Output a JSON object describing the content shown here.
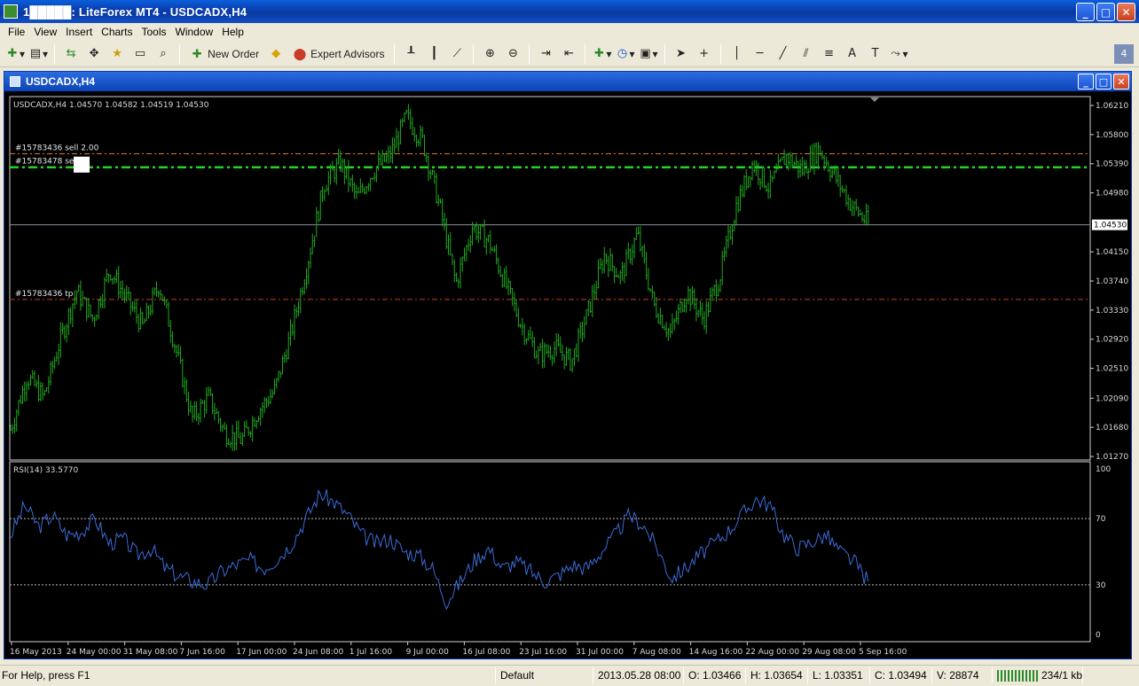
{
  "window": {
    "title": "1█████: LiteForex MT4 - USDCADX,H4"
  },
  "menu": [
    "File",
    "View",
    "Insert",
    "Charts",
    "Tools",
    "Window",
    "Help"
  ],
  "toolbar": {
    "new_order": "New Order",
    "expert_advisors": "Expert Advisors",
    "badge": "4"
  },
  "chart_window": {
    "title": "USDCADX,H4"
  },
  "chart_data": [
    {
      "type": "bar",
      "title": "USDCADX,H4  1.04570 1.04582 1.04519 1.04530",
      "symbol": "USDCADX,H4",
      "ohlc": {
        "open": 1.0457,
        "high": 1.04582,
        "low": 1.04519,
        "close": 1.0453
      },
      "price_axis_ticks": [
        "1.06210",
        "1.05800",
        "1.05390",
        "1.04980",
        "1.04150",
        "1.03740",
        "1.03330",
        "1.02920",
        "1.02510",
        "1.02090",
        "1.01680",
        "1.01270"
      ],
      "current_price": "1.04530",
      "ylim": [
        1.0127,
        1.0621
      ],
      "x_labels": [
        "16 May 2013",
        "24 May 00:00",
        "31 May 08:00",
        "7 Jun 16:00",
        "17 Jun 00:00",
        "24 Jun 08:00",
        "1 Jul 16:00",
        "9 Jul 00:00",
        "16 Jul 08:00",
        "23 Jul 16:00",
        "31 Jul 00:00",
        "7 Aug 08:00",
        "14 Aug 16:00",
        "22 Aug 00:00",
        "29 Aug 08:00",
        "5 Sep 16:00"
      ],
      "price_path": [
        1.0165,
        1.024,
        1.021,
        1.029,
        1.036,
        1.032,
        1.039,
        1.035,
        1.031,
        1.037,
        1.028,
        1.018,
        1.021,
        1.016,
        1.015,
        1.019,
        1.022,
        1.03,
        1.04,
        1.051,
        1.054,
        1.049,
        1.053,
        1.055,
        1.0605,
        1.057,
        1.048,
        1.037,
        1.045,
        1.043,
        1.037,
        1.031,
        1.027,
        1.028,
        1.026,
        1.033,
        1.041,
        1.038,
        1.044,
        1.034,
        1.03,
        1.036,
        1.032,
        1.038,
        1.048,
        1.054,
        1.0505,
        1.055,
        1.053,
        1.056,
        1.052,
        1.048,
        1.0455
      ],
      "orders": [
        {
          "label": "#15783436 sell 2.00",
          "price": 1.0553,
          "color": "#e07a1e"
        },
        {
          "label": "#15783478 sell",
          "price": 1.0534,
          "color": "#22d422"
        },
        {
          "label": "#15783436 tp",
          "price": 1.0348,
          "color": "#c83c28"
        }
      ],
      "series_color": "#1faa1f"
    },
    {
      "type": "line",
      "title": "RSI(14) 33.5770",
      "ylim": [
        0,
        100
      ],
      "y_ticks": [
        "100",
        "70",
        "30",
        "0"
      ],
      "levels": [
        70,
        30
      ],
      "rsi_path": [
        60,
        78,
        65,
        72,
        60,
        62,
        70,
        55,
        58,
        48,
        52,
        40,
        35,
        32,
        30,
        38,
        42,
        45,
        40,
        46,
        55,
        70,
        85,
        80,
        72,
        60,
        55,
        58,
        50,
        48,
        40,
        20,
        32,
        45,
        52,
        40,
        44,
        38,
        32,
        36,
        42,
        40,
        50,
        60,
        72,
        66,
        52,
        34,
        40,
        48,
        55,
        62,
        72,
        82,
        78,
        60,
        52,
        56,
        60,
        50,
        44,
        32
      ],
      "series_color": "#3a6cd8"
    }
  ],
  "status": {
    "help": "For Help, press F1",
    "profile": "Default",
    "datetime": "2013.05.28 08:00",
    "open": "O: 1.03466",
    "high": "H: 1.03654",
    "low": "L: 1.03351",
    "close": "C: 1.03494",
    "volume": "V: 28874",
    "traffic": "234/1 kb"
  }
}
